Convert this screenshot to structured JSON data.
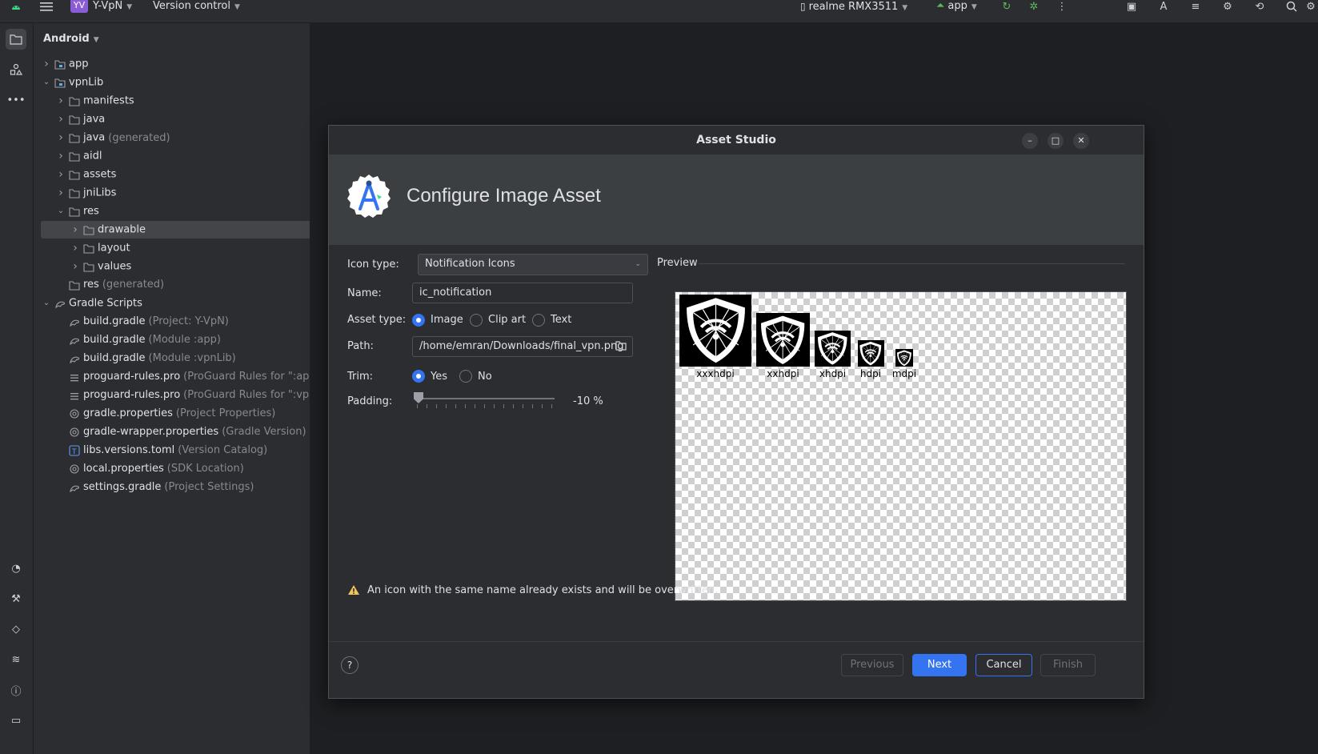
{
  "topbar": {
    "project_badge": "YV",
    "project_name": "Y-VpN",
    "vcs": "Version control",
    "device": "realme RMX3511",
    "run_config": "app"
  },
  "project_panel": {
    "view_mode": "Android",
    "tree": [
      {
        "name": "app",
        "hint": "",
        "depth": 0,
        "expanded": false,
        "icon": "module-icon"
      },
      {
        "name": "vpnLib",
        "hint": "",
        "depth": 0,
        "expanded": true,
        "icon": "module-icon"
      },
      {
        "name": "manifests",
        "hint": "",
        "depth": 1,
        "expanded": false,
        "icon": "folder-icon"
      },
      {
        "name": "java",
        "hint": "",
        "depth": 1,
        "expanded": false,
        "icon": "folder-icon"
      },
      {
        "name": "java",
        "hint": "(generated)",
        "depth": 1,
        "expanded": false,
        "icon": "folder-icon"
      },
      {
        "name": "aidl",
        "hint": "",
        "depth": 1,
        "expanded": false,
        "icon": "folder-icon"
      },
      {
        "name": "assets",
        "hint": "",
        "depth": 1,
        "expanded": false,
        "icon": "folder-icon"
      },
      {
        "name": "jniLibs",
        "hint": "",
        "depth": 1,
        "expanded": false,
        "icon": "folder-icon"
      },
      {
        "name": "res",
        "hint": "",
        "depth": 1,
        "expanded": true,
        "icon": "folder-icon"
      },
      {
        "name": "drawable",
        "hint": "",
        "depth": 2,
        "expanded": false,
        "icon": "folder-icon",
        "selected": true
      },
      {
        "name": "layout",
        "hint": "",
        "depth": 2,
        "expanded": false,
        "icon": "folder-icon"
      },
      {
        "name": "values",
        "hint": "",
        "depth": 2,
        "expanded": false,
        "icon": "folder-icon"
      },
      {
        "name": "res",
        "hint": "(generated)",
        "depth": 1,
        "leaf": true,
        "icon": "folder-icon"
      },
      {
        "name": "Gradle Scripts",
        "hint": "",
        "depth": 0,
        "expanded": true,
        "icon": "gradle-icon"
      },
      {
        "name": "build.gradle",
        "hint": "(Project: Y-VpN)",
        "depth": 1,
        "leaf": true,
        "icon": "gradle-icon"
      },
      {
        "name": "build.gradle",
        "hint": "(Module :app)",
        "depth": 1,
        "leaf": true,
        "icon": "gradle-icon"
      },
      {
        "name": "build.gradle",
        "hint": "(Module :vpnLib)",
        "depth": 1,
        "leaf": true,
        "icon": "gradle-icon"
      },
      {
        "name": "proguard-rules.pro",
        "hint": "(ProGuard Rules for \":ap",
        "depth": 1,
        "leaf": true,
        "icon": "text-file-icon"
      },
      {
        "name": "proguard-rules.pro",
        "hint": "(ProGuard Rules for \":vp",
        "depth": 1,
        "leaf": true,
        "icon": "text-file-icon"
      },
      {
        "name": "gradle.properties",
        "hint": "(Project Properties)",
        "depth": 1,
        "leaf": true,
        "icon": "settings-file-icon"
      },
      {
        "name": "gradle-wrapper.properties",
        "hint": "(Gradle Version)",
        "depth": 1,
        "leaf": true,
        "icon": "settings-file-icon"
      },
      {
        "name": "libs.versions.toml",
        "hint": "(Version Catalog)",
        "depth": 1,
        "leaf": true,
        "icon": "toml-file-icon"
      },
      {
        "name": "local.properties",
        "hint": "(SDK Location)",
        "depth": 1,
        "leaf": true,
        "icon": "settings-file-icon"
      },
      {
        "name": "settings.gradle",
        "hint": "(Project Settings)",
        "depth": 1,
        "leaf": true,
        "icon": "gradle-icon"
      }
    ]
  },
  "dialog": {
    "window_title": "Asset Studio",
    "header_title": "Configure Image Asset",
    "icon_type_label": "Icon type:",
    "icon_type_value": "Notification Icons",
    "name_label": "Name:",
    "name_value": "ic_notification",
    "asset_type_label": "Asset type:",
    "asset_type_options": [
      "Image",
      "Clip art",
      "Text"
    ],
    "asset_type_selected": "Image",
    "path_label": "Path:",
    "path_value": "/home/emran/Downloads/final_vpn.png",
    "trim_label": "Trim:",
    "trim_options": [
      "Yes",
      "No"
    ],
    "trim_selected": "Yes",
    "padding_label": "Padding:",
    "padding_value": "-10 %",
    "preview_label": "Preview",
    "densities": [
      "xxxhdpi",
      "xxhdpi",
      "xhdpi",
      "hdpi",
      "mdpi"
    ],
    "warning": "An icon with the same name already exists and will be overwritten.",
    "buttons": {
      "help": "?",
      "previous": "Previous",
      "next": "Next",
      "cancel": "Cancel",
      "finish": "Finish"
    },
    "colors": {
      "accent": "#3574f0",
      "warning": "#f2c55c"
    }
  }
}
